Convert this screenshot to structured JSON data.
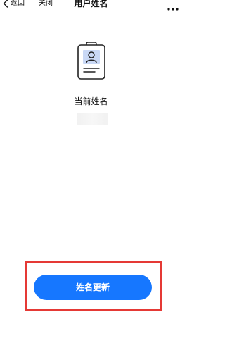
{
  "navbar": {
    "back_label": "返回",
    "close_label": "关闭",
    "title": "用户姓名"
  },
  "content": {
    "current_name_label": "当前姓名",
    "current_name_value": ""
  },
  "actions": {
    "update_button_label": "姓名更新"
  },
  "colors": {
    "primary_button": "#1677ff",
    "highlight_border": "#e53935",
    "icon_accent": "#c9d8f5"
  },
  "icons": {
    "back": "chevron-left-icon",
    "more": "more-dots-icon",
    "badge": "id-badge-icon"
  }
}
